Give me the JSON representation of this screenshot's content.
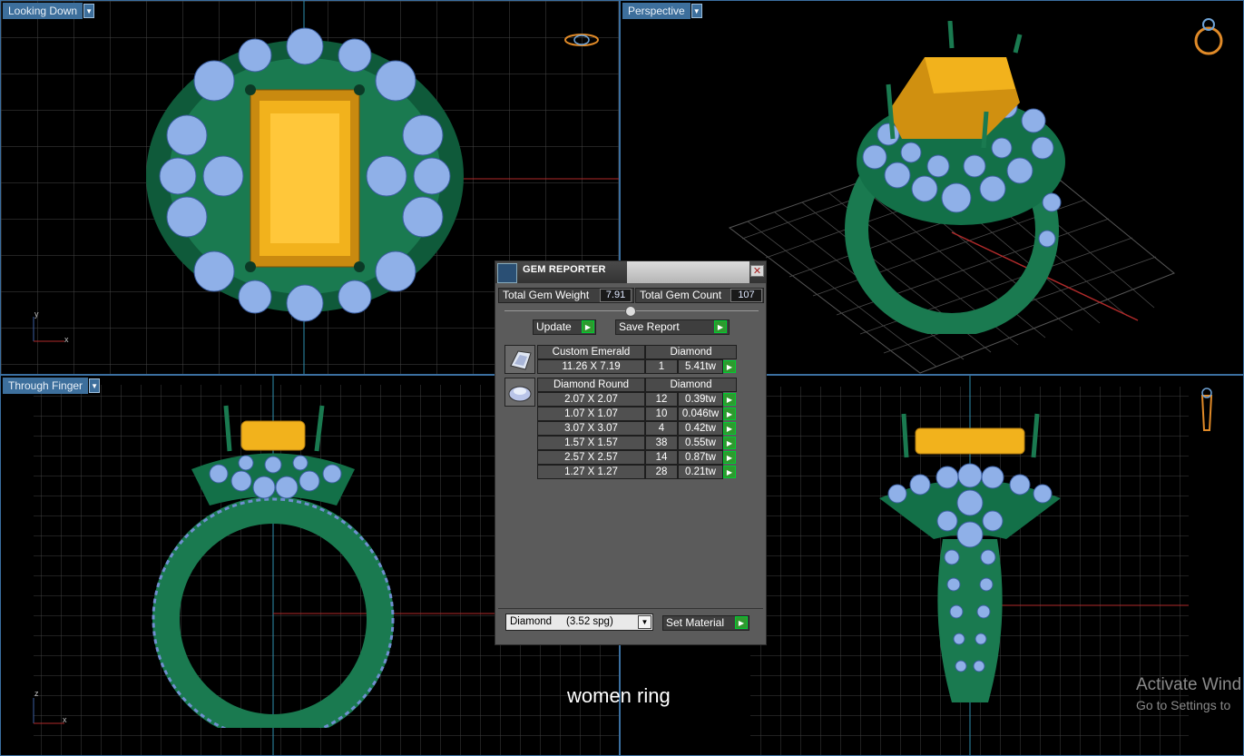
{
  "viewports": {
    "top_left": {
      "label": "Looking Down",
      "axis_a": "y",
      "axis_b": "x"
    },
    "top_right": {
      "label": "Perspective"
    },
    "bottom_left": {
      "label": "Through Finger",
      "axis_a": "z",
      "axis_b": "x"
    },
    "bottom_right": {
      "label": ""
    }
  },
  "caption": "women ring",
  "watermark": {
    "line1": "Activate Wind",
    "line2": "Go to Settings to"
  },
  "gem_reporter": {
    "title": "GEM REPORTER",
    "total_weight_label": "Total Gem Weight",
    "total_weight_value": "7.91",
    "total_count_label": "Total Gem Count",
    "total_count_value": "107",
    "update_label": "Update",
    "save_label": "Save Report",
    "groups": [
      {
        "shape": "Custom Emerald",
        "material": "Diamond",
        "icon": "emerald-gem-icon",
        "rows": [
          {
            "size": "11.26 X 7.19",
            "count": "1",
            "weight": "5.41tw"
          }
        ]
      },
      {
        "shape": "Diamond Round",
        "material": "Diamond",
        "icon": "round-gem-icon",
        "rows": [
          {
            "size": "2.07 X 2.07",
            "count": "12",
            "weight": "0.39tw"
          },
          {
            "size": "1.07 X 1.07",
            "count": "10",
            "weight": "0.046tw"
          },
          {
            "size": "3.07 X 3.07",
            "count": "4",
            "weight": "0.42tw"
          },
          {
            "size": "1.57 X 1.57",
            "count": "38",
            "weight": "0.55tw"
          },
          {
            "size": "2.57 X 2.57",
            "count": "14",
            "weight": "0.87tw"
          },
          {
            "size": "1.27 X 1.27",
            "count": "28",
            "weight": "0.21tw"
          }
        ]
      }
    ],
    "material_select": "Diamond     (3.52 spg)",
    "set_material_label": "Set Material"
  },
  "colors": {
    "grid": "#4a4a4a",
    "metal": "#1f7a52",
    "center_stone": "#f2b21c",
    "side_stone": "#8fb0e8",
    "label_bg": "#3d6f9c",
    "dialog_bg": "#5b5b5b"
  }
}
